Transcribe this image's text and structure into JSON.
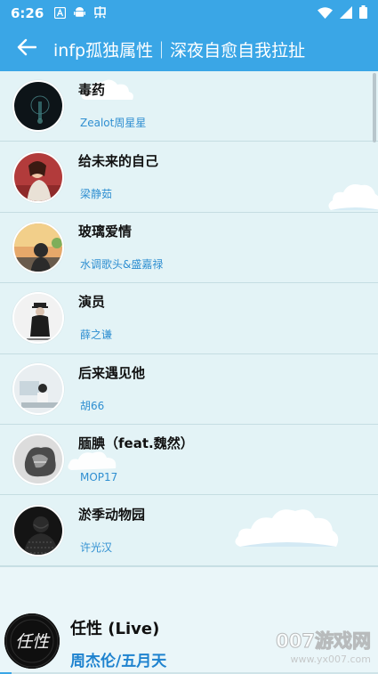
{
  "status_bar": {
    "time": "6:26",
    "left_icons": [
      "a-box-icon",
      "android-icon",
      "notification-app-icon"
    ],
    "right_icons": [
      "wifi-icon",
      "signal-icon",
      "battery-icon"
    ]
  },
  "app_bar": {
    "title": "infp孤独属性｜深夜自愈自我拉扯",
    "back_icon": "arrow-left-icon"
  },
  "songs": [
    {
      "title": "毒药",
      "artist": "Zealot周星星"
    },
    {
      "title": "给未来的自己",
      "artist": "梁静茹"
    },
    {
      "title": "玻璃爱情",
      "artist": "水调歌头&盛嘉禄"
    },
    {
      "title": "演员",
      "artist": "薛之谦"
    },
    {
      "title": "后来遇见他",
      "artist": "胡66"
    },
    {
      "title": "腼腆（feat.魏然）",
      "artist": "MOP17"
    },
    {
      "title": "淤季动物园",
      "artist": "许光汉"
    }
  ],
  "player": {
    "title": "任性 (Live)",
    "artist": "周杰伦/五月天",
    "cover_text": "任性",
    "progress": 0.03
  },
  "watermark": {
    "main": "007游戏网",
    "url": "www.yx007.com"
  },
  "colors": {
    "accent": "#3aa6e6",
    "artist_text": "#2f8fd1",
    "list_background": "#e3f3f6"
  }
}
